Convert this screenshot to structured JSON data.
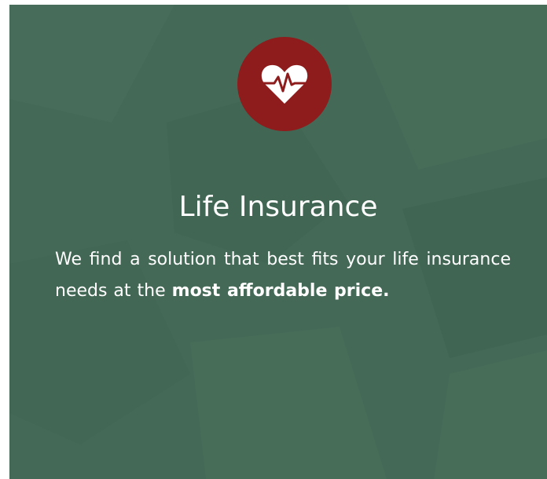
{
  "card": {
    "background_color": "#446a57",
    "icon": {
      "name": "heart-pulse-icon",
      "circle_color": "#8e1c1c"
    },
    "title": "Life Insurance",
    "description": {
      "text_before": "We find a solution that best fits your life insurance needs at the",
      "emphasis": "most affordable price."
    }
  }
}
